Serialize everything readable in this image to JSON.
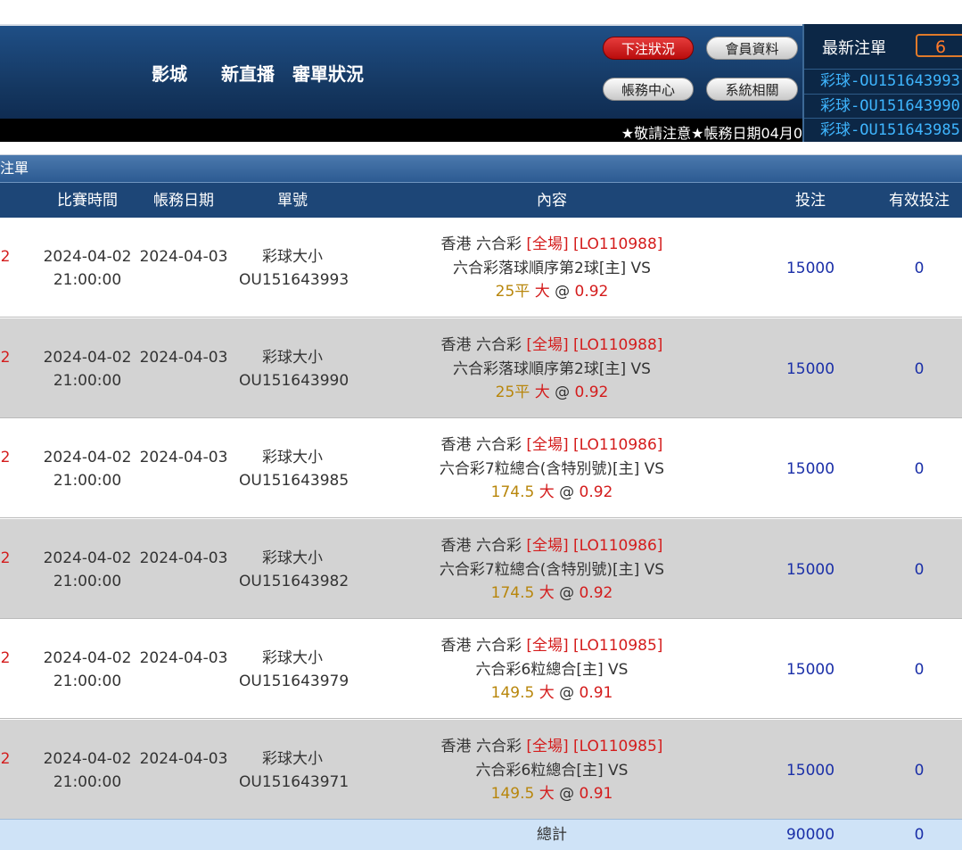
{
  "header": {
    "nav": [
      "影城",
      "新直播",
      "審單狀況"
    ],
    "buttons": {
      "bet_status": "下注狀況",
      "member_info": "會員資料",
      "account_center": "帳務中心",
      "system": "系統相關"
    },
    "ticker": "★敬請注意★帳務日期04月0"
  },
  "latest_bets": {
    "title": "最新注單",
    "count": "6",
    "items": [
      "彩球-OU151643993",
      "彩球-OU151643990",
      "彩球-OU151643985"
    ]
  },
  "section_title": "注單",
  "table": {
    "columns": [
      "比賽時間",
      "帳務日期",
      "單號",
      "內容",
      "投注",
      "有效投注"
    ],
    "rows": [
      {
        "prefix": "2",
        "match_date": "2024-04-02",
        "match_time": "21:00:00",
        "account_date": "2024-04-03",
        "bet_type": "彩球大小",
        "bet_no": "OU151643993",
        "league": "香港 六合彩",
        "period": "[全場]",
        "code": "[LO110988]",
        "game": "六合彩落球順序第2球[主] VS",
        "line": "25平",
        "pick": "大",
        "at": "@",
        "odds": "0.92",
        "stake": "15000",
        "valid": "0"
      },
      {
        "prefix": "2",
        "match_date": "2024-04-02",
        "match_time": "21:00:00",
        "account_date": "2024-04-03",
        "bet_type": "彩球大小",
        "bet_no": "OU151643990",
        "league": "香港 六合彩",
        "period": "[全場]",
        "code": "[LO110988]",
        "game": "六合彩落球順序第2球[主] VS",
        "line": "25平",
        "pick": "大",
        "at": "@",
        "odds": "0.92",
        "stake": "15000",
        "valid": "0"
      },
      {
        "prefix": "2",
        "match_date": "2024-04-02",
        "match_time": "21:00:00",
        "account_date": "2024-04-03",
        "bet_type": "彩球大小",
        "bet_no": "OU151643985",
        "league": "香港 六合彩",
        "period": "[全場]",
        "code": "[LO110986]",
        "game": "六合彩7粒總合(含特別號)[主] VS",
        "line": "174.5",
        "pick": "大",
        "at": "@",
        "odds": "0.92",
        "stake": "15000",
        "valid": "0"
      },
      {
        "prefix": "2",
        "match_date": "2024-04-02",
        "match_time": "21:00:00",
        "account_date": "2024-04-03",
        "bet_type": "彩球大小",
        "bet_no": "OU151643982",
        "league": "香港 六合彩",
        "period": "[全場]",
        "code": "[LO110986]",
        "game": "六合彩7粒總合(含特別號)[主] VS",
        "line": "174.5",
        "pick": "大",
        "at": "@",
        "odds": "0.92",
        "stake": "15000",
        "valid": "0"
      },
      {
        "prefix": "2",
        "match_date": "2024-04-02",
        "match_time": "21:00:00",
        "account_date": "2024-04-03",
        "bet_type": "彩球大小",
        "bet_no": "OU151643979",
        "league": "香港 六合彩",
        "period": "[全場]",
        "code": "[LO110985]",
        "game": "六合彩6粒總合[主] VS",
        "line": "149.5",
        "pick": "大",
        "at": "@",
        "odds": "0.91",
        "stake": "15000",
        "valid": "0"
      },
      {
        "prefix": "2",
        "match_date": "2024-04-02",
        "match_time": "21:00:00",
        "account_date": "2024-04-03",
        "bet_type": "彩球大小",
        "bet_no": "OU151643971",
        "league": "香港 六合彩",
        "period": "[全場]",
        "code": "[LO110985]",
        "game": "六合彩6粒總合[主] VS",
        "line": "149.5",
        "pick": "大",
        "at": "@",
        "odds": "0.91",
        "stake": "15000",
        "valid": "0"
      }
    ],
    "total": {
      "label": "總計",
      "stake": "90000",
      "valid": "0"
    }
  },
  "colors": {
    "header": "#1f4f86",
    "row_alt": "#d3d3d3",
    "red": "#d41c1c",
    "gold": "#b8860b",
    "blue": "#1a2fa8"
  }
}
